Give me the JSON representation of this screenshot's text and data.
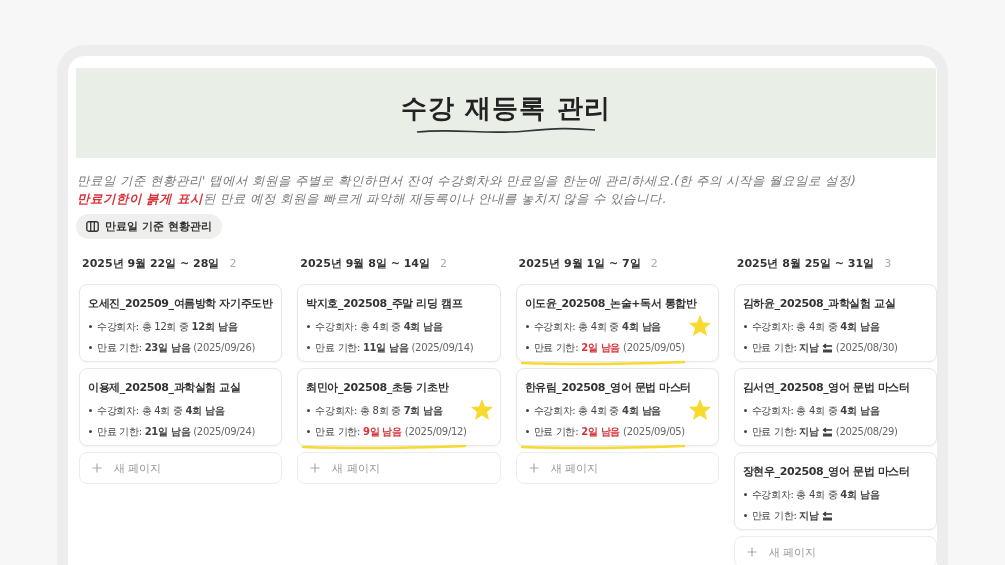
{
  "header": {
    "title": "수강 재등록 관리"
  },
  "description": [
    [
      {
        "text": "만료일 기준 현황관리' 탭에서 회원을 주별로 확인하면서 잔여 수강회차와 만료일을 한눈에 관리하세요.(한 주의 시작을 월요일로 설정)",
        "emphasis": false
      }
    ],
    [
      {
        "text": "만료기한이 붉게 표시",
        "emphasis": true
      },
      {
        "text": "된 만료 예정 회원을 빠르게 파악해 재등록이나 안내를 놓치지 않을 수 있습니다.",
        "emphasis": false
      }
    ]
  ],
  "view_tab": {
    "label": "만료일 기준 현황관리",
    "selected": true
  },
  "columns": [
    {
      "title": "2025년 9월 22일 ~ 28일",
      "count": "2",
      "new_page": "새 페이지",
      "cards": [
        {
          "title": "오세진_202509_여름방학 자기주도반",
          "sessions_label": "수강회차: 총 12회 중",
          "sessions_left": "12회 남음",
          "expiry_label": "만료 기한:",
          "expiry_status": "23일 남음",
          "urgent": false,
          "end_icon": false,
          "expiry_date": "(2025/09/26)",
          "starred": false
        },
        {
          "title": "이용제_202508_과학실험 교실",
          "sessions_label": "수강회차: 총 4회 중",
          "sessions_left": "4회 남음",
          "expiry_label": "만료 기한:",
          "expiry_status": "21일 남음",
          "urgent": false,
          "end_icon": false,
          "expiry_date": "(2025/09/24)",
          "starred": false
        }
      ]
    },
    {
      "title": "2025년 9월 8일 ~ 14일",
      "count": "2",
      "new_page": "새 페이지",
      "cards": [
        {
          "title": "박지호_202508_주말 리딩 캠프",
          "sessions_label": "수강회차: 총 4회 중",
          "sessions_left": "4회 남음",
          "expiry_label": "만료 기한:",
          "expiry_status": "11일 남음",
          "urgent": false,
          "end_icon": false,
          "expiry_date": "(2025/09/14)",
          "starred": false
        },
        {
          "title": "최민아_202508_초등 기초반",
          "sessions_label": "수강회차: 총 8회 중",
          "sessions_left": "7회 남음",
          "expiry_label": "만료 기한:",
          "expiry_status": "9일 남음",
          "urgent": true,
          "end_icon": false,
          "expiry_date": "(2025/09/12)",
          "starred": true
        }
      ]
    },
    {
      "title": "2025년 9월 1일 ~ 7일",
      "count": "2",
      "new_page": "새 페이지",
      "cards": [
        {
          "title": "이도윤_202508_논술+독서 통합반",
          "sessions_label": "수강회차: 총 4회 중",
          "sessions_left": "4회 남음",
          "expiry_label": "만료 기한:",
          "expiry_status": "2일 남음",
          "urgent": true,
          "end_icon": false,
          "expiry_date": "(2025/09/05)",
          "starred": true
        },
        {
          "title": "한유림_202508_영어 문법 마스터",
          "sessions_label": "수강회차: 총 4회 중",
          "sessions_left": "4회 남음",
          "expiry_label": "만료 기한:",
          "expiry_status": "2일 남음",
          "urgent": true,
          "end_icon": false,
          "expiry_date": "(2025/09/05)",
          "starred": true
        }
      ]
    },
    {
      "title": "2025년 8월 25일 ~ 31일",
      "count": "3",
      "new_page": "새 페이지",
      "cards": [
        {
          "title": "김하윤_202508_과학실험 교실",
          "sessions_label": "수강회차: 총 4회 중",
          "sessions_left": "4회 남음",
          "expiry_label": "만료 기한:",
          "expiry_status": "지남",
          "urgent": false,
          "end_icon": true,
          "expiry_date": "(2025/08/30)",
          "starred": false
        },
        {
          "title": "김서연_202508_영어 문법 마스터",
          "sessions_label": "수강회차: 총 4회 중",
          "sessions_left": "4회 남음",
          "expiry_label": "만료 기한:",
          "expiry_status": "지남",
          "urgent": false,
          "end_icon": true,
          "expiry_date": "(2025/08/29)",
          "starred": false
        },
        {
          "title": "장현우_202508_영어 문법 마스터",
          "sessions_label": "수강회차: 총 4회 중",
          "sessions_left": "4회 남음",
          "expiry_label": "만료 기한:",
          "expiry_status": "지남",
          "urgent": false,
          "end_icon": true,
          "starred": false
        }
      ]
    }
  ]
}
